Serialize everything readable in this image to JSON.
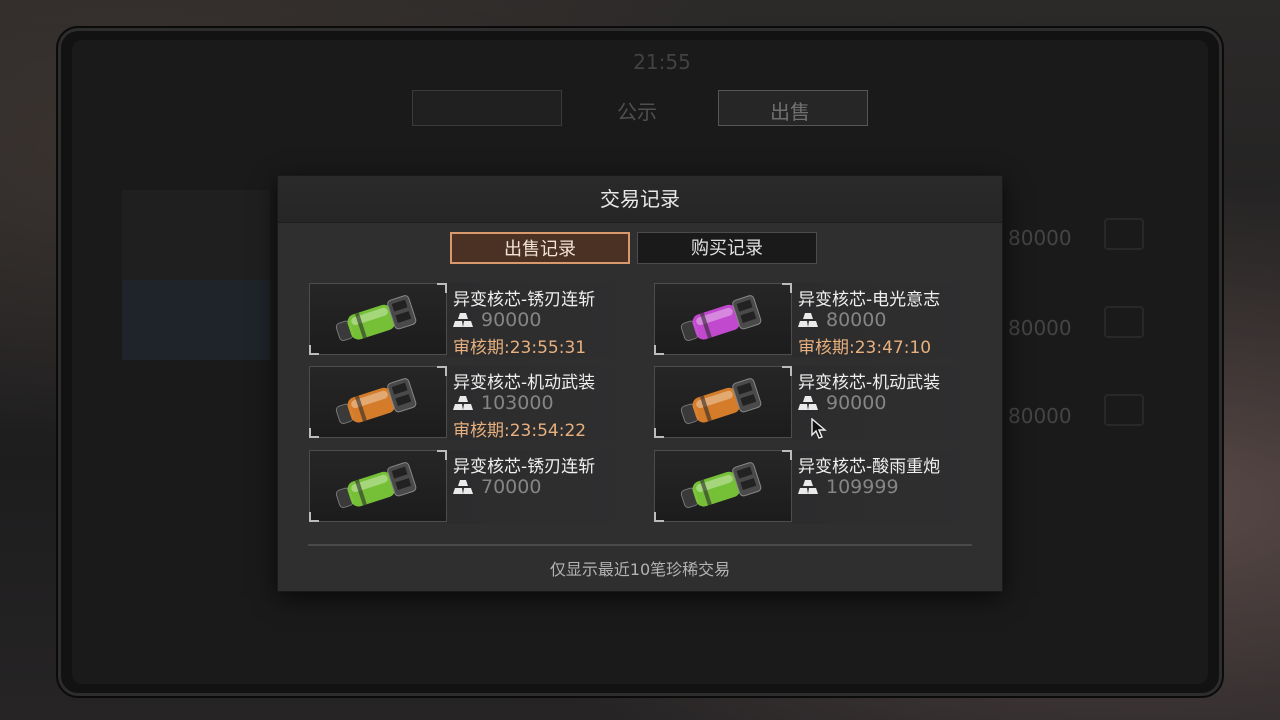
{
  "underlying": {
    "status_time": "21:55",
    "tabs": [
      "",
      "公示",
      "出售"
    ],
    "rows_price": [
      "80000",
      "80000",
      "80000"
    ]
  },
  "modal": {
    "title": "交易记录",
    "tab_sell": "出售记录",
    "tab_buy": "购买记录",
    "footer_note": "仅显示最近10笔珍稀交易"
  },
  "items": [
    {
      "name": "异变核芯-锈刃连斩",
      "price": "90000",
      "review": "审核期:23:55:31",
      "color": "green",
      "accent": "#7fd23a"
    },
    {
      "name": "异变核芯-电光意志",
      "price": "80000",
      "review": "审核期:23:47:10",
      "color": "purple",
      "accent": "#d24ee0"
    },
    {
      "name": "异变核芯-机动武装",
      "price": "103000",
      "review": "审核期:23:54:22",
      "color": "orange",
      "accent": "#e8862a"
    },
    {
      "name": "异变核芯-机动武装",
      "price": "90000",
      "review": "",
      "color": "orange",
      "accent": "#e8862a"
    },
    {
      "name": "异变核芯-锈刃连斩",
      "price": "70000",
      "review": "",
      "color": "green",
      "accent": "#7fd23a"
    },
    {
      "name": "异变核芯-酸雨重炮",
      "price": "109999",
      "review": "",
      "color": "green",
      "accent": "#7fd23a"
    }
  ],
  "icons": {
    "coin": "gold-ingot-icon",
    "item": "core-capsule-icon",
    "cursor": "mouse-cursor-icon"
  }
}
